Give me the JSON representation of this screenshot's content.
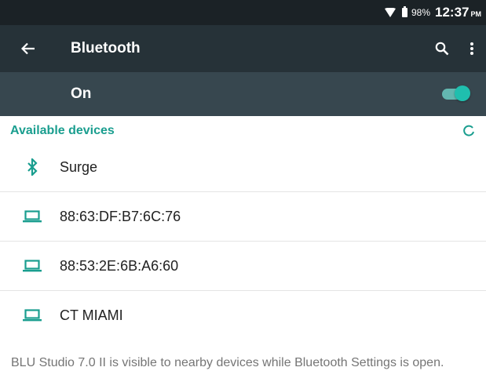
{
  "status_bar": {
    "battery_percent": "98%",
    "time": "12:37",
    "ampm": "PM",
    "icons": [
      "wifi-icon",
      "battery-icon"
    ]
  },
  "app_bar": {
    "title": "Bluetooth",
    "icons": [
      "back-arrow-icon",
      "search-icon",
      "more-vert-icon"
    ]
  },
  "master_switch": {
    "label": "On",
    "enabled": true
  },
  "available": {
    "title": "Available devices",
    "refresh_icon": "refresh-icon",
    "devices": [
      {
        "name": "Surge",
        "icon": "bluetooth-icon"
      },
      {
        "name": "88:63:DF:B7:6C:76",
        "icon": "laptop-icon"
      },
      {
        "name": "88:53:2E:6B:A6:60",
        "icon": "laptop-icon"
      },
      {
        "name": "CT MIAMI",
        "icon": "laptop-icon"
      }
    ]
  },
  "footer": {
    "visibility_text": "BLU Studio 7.0 II is visible to nearby devices while Bluetooth Settings is open."
  },
  "colors": {
    "status_bar": "#1b2226",
    "app_bar": "#263238",
    "switch_bar": "#37474f",
    "accent": "#1a9e8f"
  }
}
